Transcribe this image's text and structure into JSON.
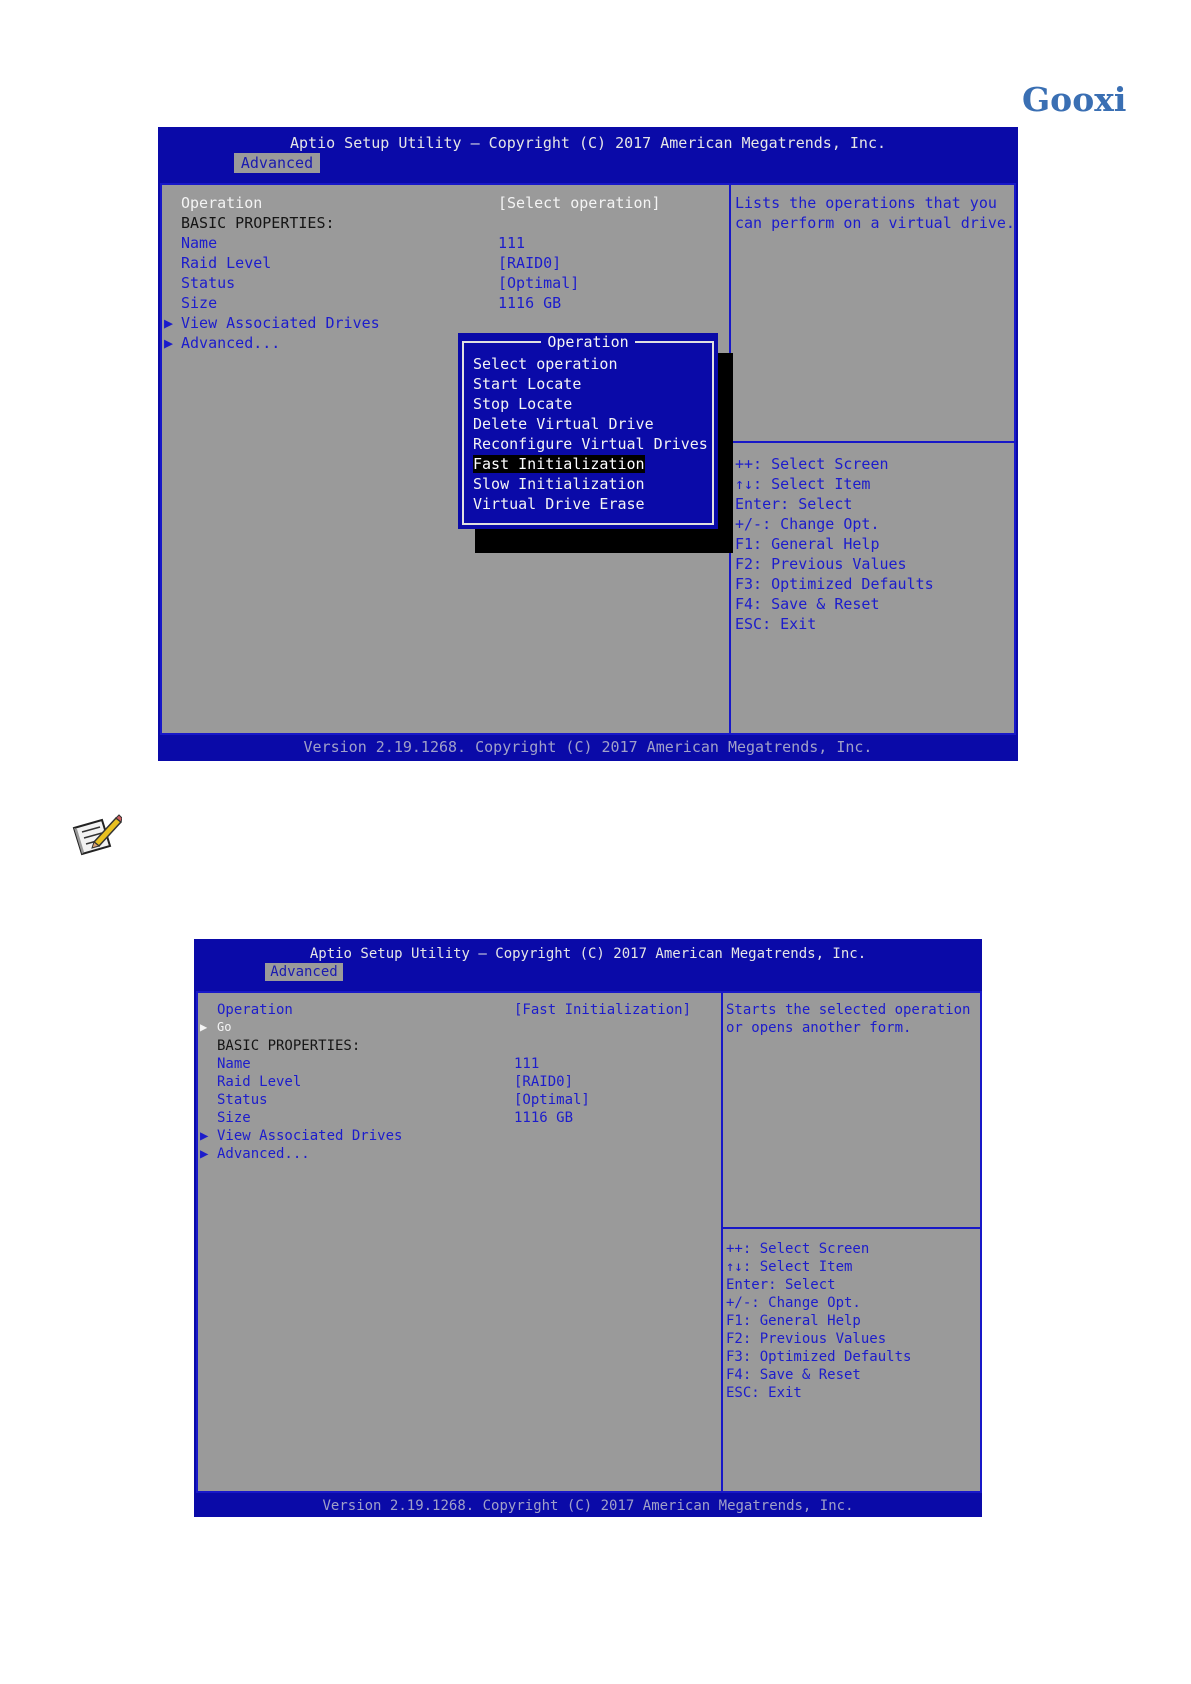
{
  "logo": "Gooxi",
  "note_icon": "note-pencil-icon",
  "screen1": {
    "title": "Aptio Setup Utility – Copyright (C) 2017 American Megatrends, Inc.",
    "tab": "Advanced",
    "footer": "Version 2.19.1268. Copyright (C) 2017 American Megatrends, Inc.",
    "rows": {
      "operation": {
        "label": "Operation",
        "value": "[Select operation]"
      },
      "basic": "BASIC PROPERTIES:",
      "name": {
        "label": "Name",
        "value": "111"
      },
      "raid": {
        "label": "Raid Level",
        "value": "[RAID0]"
      },
      "status": {
        "label": "Status",
        "value": "[Optimal]"
      },
      "size": {
        "label": "Size",
        "value": "1116 GB"
      },
      "drives": "View Associated Drives",
      "advanced": "Advanced..."
    },
    "help": [
      "Lists the operations that you",
      "can perform on a virtual drive."
    ],
    "keys": [
      "++: Select Screen",
      "↑↓: Select Item",
      "Enter: Select",
      "+/-: Change Opt.",
      "F1: General Help",
      "F2: Previous Values",
      "F3: Optimized Defaults",
      "F4: Save & Reset",
      "ESC: Exit"
    ],
    "popup": {
      "title": "Operation",
      "options": [
        "Select operation",
        "Start Locate",
        "Stop Locate",
        "Delete Virtual Drive",
        "Reconfigure Virtual Drives",
        "Fast Initialization",
        "Slow Initialization",
        "Virtual Drive Erase"
      ],
      "selected": "Fast Initialization"
    }
  },
  "screen2": {
    "title": "Aptio Setup Utility – Copyright (C) 2017 American Megatrends, Inc.",
    "tab": "Advanced",
    "footer": "Version 2.19.1268. Copyright (C) 2017 American Megatrends, Inc.",
    "rows": {
      "operation": {
        "label": "Operation",
        "value": "[Fast Initialization]"
      },
      "go": "Go",
      "basic": "BASIC PROPERTIES:",
      "name": {
        "label": "Name",
        "value": "111"
      },
      "raid": {
        "label": "Raid Level",
        "value": "[RAID0]"
      },
      "status": {
        "label": "Status",
        "value": "[Optimal]"
      },
      "size": {
        "label": "Size",
        "value": "1116 GB"
      },
      "drives": "View Associated Drives",
      "advanced": "Advanced..."
    },
    "help": [
      "Starts the selected operation",
      "or opens another form."
    ],
    "keys": [
      "++: Select Screen",
      "↑↓: Select Item",
      "Enter: Select",
      "+/-: Change Opt.",
      "F1: General Help",
      "F2: Previous Values",
      "F3: Optimized Defaults",
      "F4: Save & Reset",
      "ESC: Exit"
    ]
  }
}
